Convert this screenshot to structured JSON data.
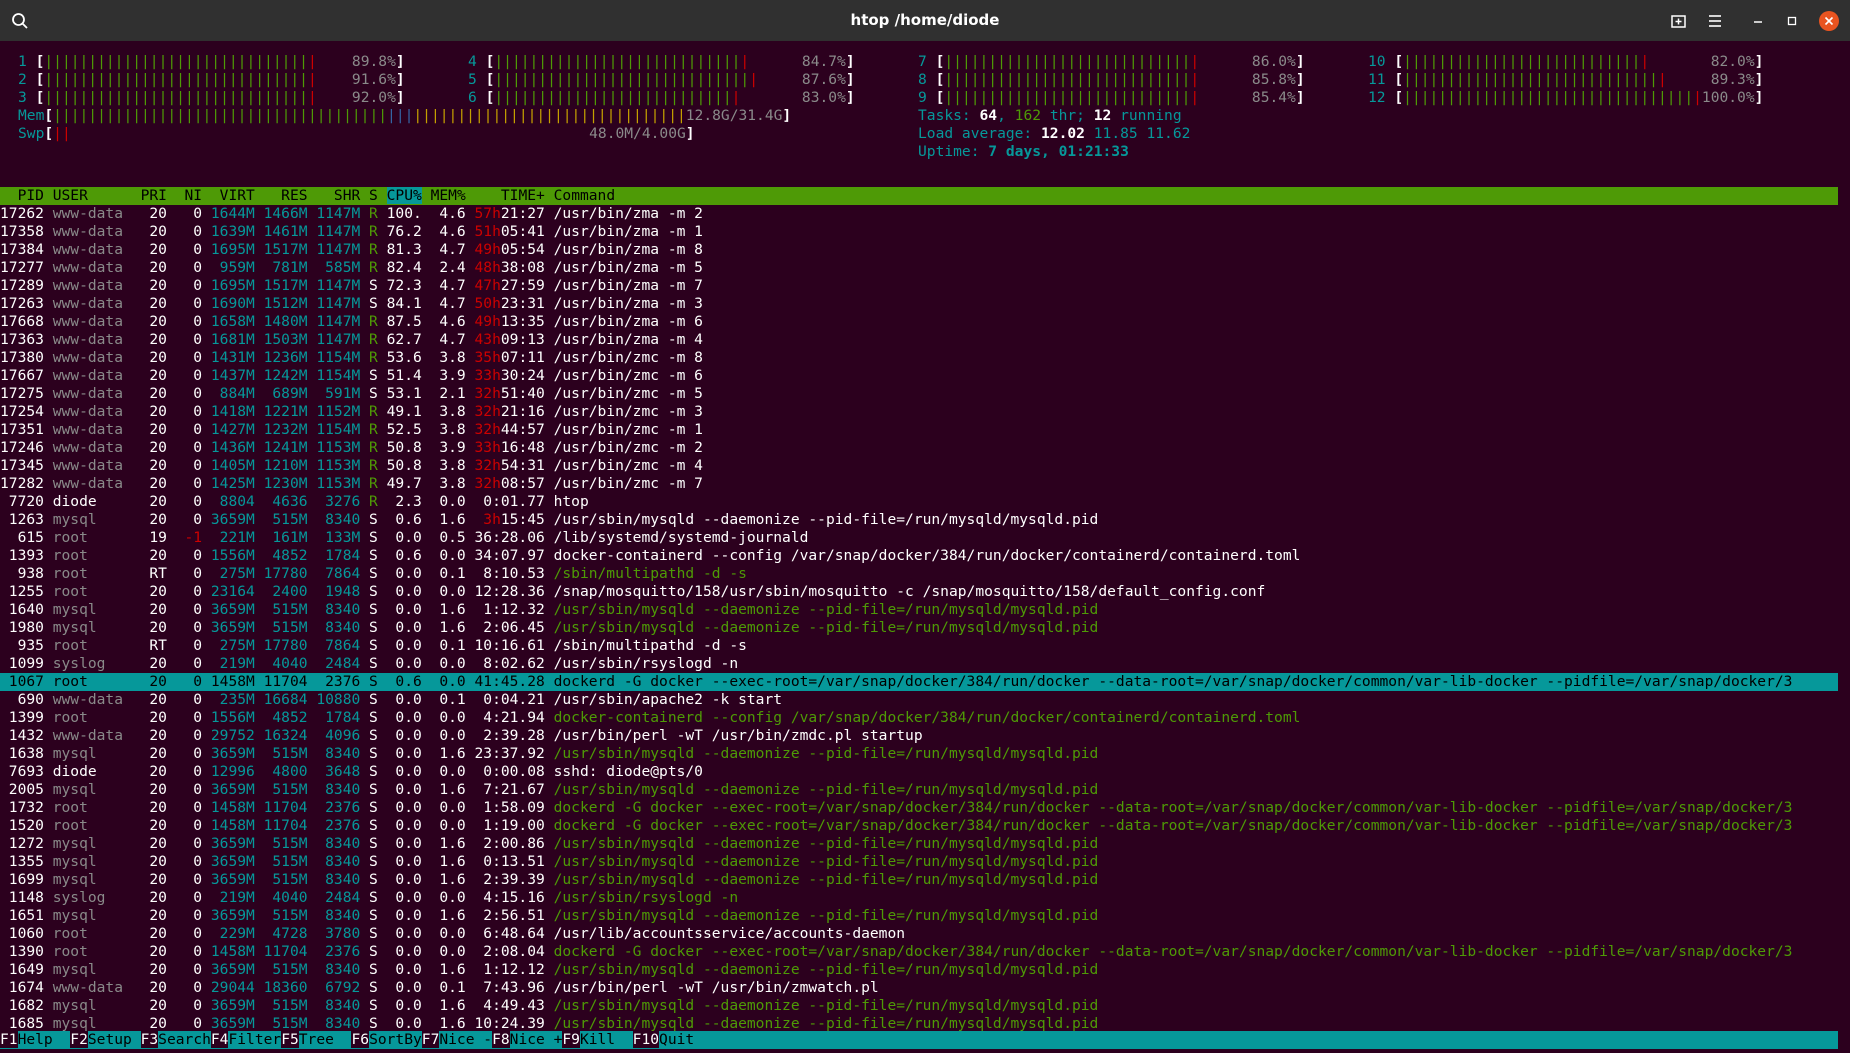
{
  "window": {
    "title": "htop /home/diode"
  },
  "meters": {
    "cpus": [
      {
        "id": "1",
        "pct": 89.8,
        "label": "89.8%"
      },
      {
        "id": "2",
        "pct": 91.6,
        "label": "91.6%"
      },
      {
        "id": "3",
        "pct": 92.0,
        "label": "92.0%"
      },
      {
        "id": "4",
        "pct": 84.7,
        "label": "84.7%"
      },
      {
        "id": "5",
        "pct": 87.6,
        "label": "87.6%"
      },
      {
        "id": "6",
        "pct": 83.0,
        "label": "83.0%"
      },
      {
        "id": "7",
        "pct": 86.0,
        "label": "86.0%"
      },
      {
        "id": "8",
        "pct": 85.8,
        "label": "85.8%"
      },
      {
        "id": "9",
        "pct": 85.4,
        "label": "85.4%"
      },
      {
        "id": "10",
        "pct": 82.0,
        "label": "82.0%"
      },
      {
        "id": "11",
        "pct": 89.3,
        "label": "89.3%"
      },
      {
        "id": "12",
        "pct": 100.0,
        "label": "100.0%"
      }
    ],
    "mem": {
      "label": "Mem",
      "value": "12.8G/31.4G",
      "pct": 40.8
    },
    "swp": {
      "label": "Swp",
      "value": "48.0M/4.00G",
      "pct": 1.2
    },
    "tasks": {
      "prefix": "Tasks: ",
      "tasks": "64",
      "sep1": ", ",
      "thr": "162",
      "sep2": " thr; ",
      "running": "12",
      "suffix": " running"
    },
    "load": {
      "prefix": "Load average: ",
      "l1": "12.02",
      "l5": "11.85",
      "l15": "11.62"
    },
    "uptime": {
      "prefix": "Uptime: ",
      "value": "7 days, 01:21:33"
    }
  },
  "columns": [
    "PID",
    "USER",
    "PRI",
    "NI",
    "VIRT",
    "RES",
    "SHR",
    "S",
    "CPU%",
    "MEM%",
    "TIME+",
    "Command"
  ],
  "sort_column": "CPU%",
  "selected_pid": "1067",
  "processes": [
    {
      "pid": "17262",
      "user": "www-data",
      "pri": "20",
      "ni": "0",
      "virt": "1644M",
      "res": "1466M",
      "shr": "1147M",
      "s": "R",
      "cpu": "100.",
      "mem": "4.6",
      "time": "57h21:27",
      "cmd": "/usr/bin/zma -m 2"
    },
    {
      "pid": "17358",
      "user": "www-data",
      "pri": "20",
      "ni": "0",
      "virt": "1639M",
      "res": "1461M",
      "shr": "1147M",
      "s": "R",
      "cpu": "76.2",
      "mem": "4.6",
      "time": "51h05:41",
      "cmd": "/usr/bin/zma -m 1"
    },
    {
      "pid": "17384",
      "user": "www-data",
      "pri": "20",
      "ni": "0",
      "virt": "1695M",
      "res": "1517M",
      "shr": "1147M",
      "s": "R",
      "cpu": "81.3",
      "mem": "4.7",
      "time": "49h05:54",
      "cmd": "/usr/bin/zma -m 8"
    },
    {
      "pid": "17277",
      "user": "www-data",
      "pri": "20",
      "ni": "0",
      "virt": "959M",
      "res": "781M",
      "shr": "585M",
      "s": "R",
      "cpu": "82.4",
      "mem": "2.4",
      "time": "48h38:08",
      "cmd": "/usr/bin/zma -m 5"
    },
    {
      "pid": "17289",
      "user": "www-data",
      "pri": "20",
      "ni": "0",
      "virt": "1695M",
      "res": "1517M",
      "shr": "1147M",
      "s": "S",
      "cpu": "72.3",
      "mem": "4.7",
      "time": "47h27:59",
      "cmd": "/usr/bin/zma -m 7"
    },
    {
      "pid": "17263",
      "user": "www-data",
      "pri": "20",
      "ni": "0",
      "virt": "1690M",
      "res": "1512M",
      "shr": "1147M",
      "s": "S",
      "cpu": "84.1",
      "mem": "4.7",
      "time": "50h23:31",
      "cmd": "/usr/bin/zma -m 3"
    },
    {
      "pid": "17668",
      "user": "www-data",
      "pri": "20",
      "ni": "0",
      "virt": "1658M",
      "res": "1480M",
      "shr": "1147M",
      "s": "R",
      "cpu": "87.5",
      "mem": "4.6",
      "time": "49h13:35",
      "cmd": "/usr/bin/zma -m 6"
    },
    {
      "pid": "17363",
      "user": "www-data",
      "pri": "20",
      "ni": "0",
      "virt": "1681M",
      "res": "1503M",
      "shr": "1147M",
      "s": "R",
      "cpu": "62.7",
      "mem": "4.7",
      "time": "43h09:13",
      "cmd": "/usr/bin/zma -m 4"
    },
    {
      "pid": "17380",
      "user": "www-data",
      "pri": "20",
      "ni": "0",
      "virt": "1431M",
      "res": "1236M",
      "shr": "1154M",
      "s": "R",
      "cpu": "53.6",
      "mem": "3.8",
      "time": "35h07:11",
      "cmd": "/usr/bin/zmc -m 8"
    },
    {
      "pid": "17667",
      "user": "www-data",
      "pri": "20",
      "ni": "0",
      "virt": "1437M",
      "res": "1242M",
      "shr": "1154M",
      "s": "S",
      "cpu": "51.4",
      "mem": "3.9",
      "time": "33h30:24",
      "cmd": "/usr/bin/zmc -m 6"
    },
    {
      "pid": "17275",
      "user": "www-data",
      "pri": "20",
      "ni": "0",
      "virt": "884M",
      "res": "689M",
      "shr": "591M",
      "s": "S",
      "cpu": "53.1",
      "mem": "2.1",
      "time": "32h51:40",
      "cmd": "/usr/bin/zmc -m 5"
    },
    {
      "pid": "17254",
      "user": "www-data",
      "pri": "20",
      "ni": "0",
      "virt": "1418M",
      "res": "1221M",
      "shr": "1152M",
      "s": "R",
      "cpu": "49.1",
      "mem": "3.8",
      "time": "32h21:16",
      "cmd": "/usr/bin/zmc -m 3"
    },
    {
      "pid": "17351",
      "user": "www-data",
      "pri": "20",
      "ni": "0",
      "virt": "1427M",
      "res": "1232M",
      "shr": "1154M",
      "s": "R",
      "cpu": "52.5",
      "mem": "3.8",
      "time": "32h44:57",
      "cmd": "/usr/bin/zmc -m 1"
    },
    {
      "pid": "17246",
      "user": "www-data",
      "pri": "20",
      "ni": "0",
      "virt": "1436M",
      "res": "1241M",
      "shr": "1153M",
      "s": "R",
      "cpu": "50.8",
      "mem": "3.9",
      "time": "33h16:48",
      "cmd": "/usr/bin/zmc -m 2"
    },
    {
      "pid": "17345",
      "user": "www-data",
      "pri": "20",
      "ni": "0",
      "virt": "1405M",
      "res": "1210M",
      "shr": "1153M",
      "s": "R",
      "cpu": "50.8",
      "mem": "3.8",
      "time": "32h54:31",
      "cmd": "/usr/bin/zmc -m 4"
    },
    {
      "pid": "17282",
      "user": "www-data",
      "pri": "20",
      "ni": "0",
      "virt": "1425M",
      "res": "1230M",
      "shr": "1153M",
      "s": "R",
      "cpu": "49.7",
      "mem": "3.8",
      "time": "32h08:57",
      "cmd": "/usr/bin/zmc -m 7"
    },
    {
      "pid": "7720",
      "user": "diode",
      "pri": "20",
      "ni": "0",
      "virt": "8804",
      "res": "4636",
      "shr": "3276",
      "s": "R",
      "cpu": "2.3",
      "mem": "0.0",
      "time": "0:01.77",
      "cmd": "htop"
    },
    {
      "pid": "1263",
      "user": "mysql",
      "pri": "20",
      "ni": "0",
      "virt": "3659M",
      "res": "515M",
      "shr": "8340",
      "s": "S",
      "cpu": "0.6",
      "mem": "1.6",
      "time": "3h15:45",
      "cmd": "/usr/sbin/mysqld --daemonize --pid-file=/run/mysqld/mysqld.pid"
    },
    {
      "pid": "615",
      "user": "root",
      "pri": "19",
      "ni": "-1",
      "virt": "221M",
      "res": "161M",
      "shr": "133M",
      "s": "S",
      "cpu": "0.0",
      "mem": "0.5",
      "time": "36:28.06",
      "cmd": "/lib/systemd/systemd-journald"
    },
    {
      "pid": "1393",
      "user": "root",
      "pri": "20",
      "ni": "0",
      "virt": "1556M",
      "res": "4852",
      "shr": "1784",
      "s": "S",
      "cpu": "0.6",
      "mem": "0.0",
      "time": "34:07.97",
      "cmd": "docker-containerd --config /var/snap/docker/384/run/docker/containerd/containerd.toml"
    },
    {
      "pid": "938",
      "user": "root",
      "pri": "RT",
      "ni": "0",
      "virt": "275M",
      "res": "17780",
      "shr": "7864",
      "s": "S",
      "cpu": "0.0",
      "mem": "0.1",
      "time": "8:10.53",
      "cmd": "/sbin/multipathd -d -s",
      "thread": true
    },
    {
      "pid": "1255",
      "user": "root",
      "pri": "20",
      "ni": "0",
      "virt": "23164",
      "res": "2400",
      "shr": "1948",
      "s": "S",
      "cpu": "0.0",
      "mem": "0.0",
      "time": "12:28.36",
      "cmd": "/snap/mosquitto/158/usr/sbin/mosquitto -c /snap/mosquitto/158/default_config.conf"
    },
    {
      "pid": "1640",
      "user": "mysql",
      "pri": "20",
      "ni": "0",
      "virt": "3659M",
      "res": "515M",
      "shr": "8340",
      "s": "S",
      "cpu": "0.0",
      "mem": "1.6",
      "time": "1:12.32",
      "cmd": "/usr/sbin/mysqld --daemonize --pid-file=/run/mysqld/mysqld.pid",
      "thread": true
    },
    {
      "pid": "1980",
      "user": "mysql",
      "pri": "20",
      "ni": "0",
      "virt": "3659M",
      "res": "515M",
      "shr": "8340",
      "s": "S",
      "cpu": "0.0",
      "mem": "1.6",
      "time": "2:06.45",
      "cmd": "/usr/sbin/mysqld --daemonize --pid-file=/run/mysqld/mysqld.pid",
      "thread": true
    },
    {
      "pid": "935",
      "user": "root",
      "pri": "RT",
      "ni": "0",
      "virt": "275M",
      "res": "17780",
      "shr": "7864",
      "s": "S",
      "cpu": "0.0",
      "mem": "0.1",
      "time": "10:16.61",
      "cmd": "/sbin/multipathd -d -s"
    },
    {
      "pid": "1099",
      "user": "syslog",
      "pri": "20",
      "ni": "0",
      "virt": "219M",
      "res": "4040",
      "shr": "2484",
      "s": "S",
      "cpu": "0.0",
      "mem": "0.0",
      "time": "8:02.62",
      "cmd": "/usr/sbin/rsyslogd -n"
    },
    {
      "pid": "1067",
      "user": "root",
      "pri": "20",
      "ni": "0",
      "virt": "1458M",
      "res": "11704",
      "shr": "2376",
      "s": "S",
      "cpu": "0.6",
      "mem": "0.0",
      "time": "41:45.28",
      "cmd": "dockerd -G docker --exec-root=/var/snap/docker/384/run/docker --data-root=/var/snap/docker/common/var-lib-docker --pidfile=/var/snap/docker/3"
    },
    {
      "pid": "690",
      "user": "www-data",
      "pri": "20",
      "ni": "0",
      "virt": "235M",
      "res": "16684",
      "shr": "10880",
      "s": "S",
      "cpu": "0.0",
      "mem": "0.1",
      "time": "0:04.21",
      "cmd": "/usr/sbin/apache2 -k start"
    },
    {
      "pid": "1399",
      "user": "root",
      "pri": "20",
      "ni": "0",
      "virt": "1556M",
      "res": "4852",
      "shr": "1784",
      "s": "S",
      "cpu": "0.0",
      "mem": "0.0",
      "time": "4:21.94",
      "cmd": "docker-containerd --config /var/snap/docker/384/run/docker/containerd/containerd.toml",
      "thread": true
    },
    {
      "pid": "1432",
      "user": "www-data",
      "pri": "20",
      "ni": "0",
      "virt": "29752",
      "res": "16324",
      "shr": "4096",
      "s": "S",
      "cpu": "0.0",
      "mem": "0.0",
      "time": "2:39.28",
      "cmd": "/usr/bin/perl -wT /usr/bin/zmdc.pl startup"
    },
    {
      "pid": "1638",
      "user": "mysql",
      "pri": "20",
      "ni": "0",
      "virt": "3659M",
      "res": "515M",
      "shr": "8340",
      "s": "S",
      "cpu": "0.0",
      "mem": "1.6",
      "time": "23:37.92",
      "cmd": "/usr/sbin/mysqld --daemonize --pid-file=/run/mysqld/mysqld.pid",
      "thread": true
    },
    {
      "pid": "7693",
      "user": "diode",
      "pri": "20",
      "ni": "0",
      "virt": "12996",
      "res": "4800",
      "shr": "3648",
      "s": "S",
      "cpu": "0.0",
      "mem": "0.0",
      "time": "0:00.08",
      "cmd": "sshd: diode@pts/0"
    },
    {
      "pid": "2005",
      "user": "mysql",
      "pri": "20",
      "ni": "0",
      "virt": "3659M",
      "res": "515M",
      "shr": "8340",
      "s": "S",
      "cpu": "0.0",
      "mem": "1.6",
      "time": "7:21.67",
      "cmd": "/usr/sbin/mysqld --daemonize --pid-file=/run/mysqld/mysqld.pid",
      "thread": true
    },
    {
      "pid": "1732",
      "user": "root",
      "pri": "20",
      "ni": "0",
      "virt": "1458M",
      "res": "11704",
      "shr": "2376",
      "s": "S",
      "cpu": "0.0",
      "mem": "0.0",
      "time": "1:58.09",
      "cmd": "dockerd -G docker --exec-root=/var/snap/docker/384/run/docker --data-root=/var/snap/docker/common/var-lib-docker --pidfile=/var/snap/docker/3",
      "thread": true
    },
    {
      "pid": "1520",
      "user": "root",
      "pri": "20",
      "ni": "0",
      "virt": "1458M",
      "res": "11704",
      "shr": "2376",
      "s": "S",
      "cpu": "0.0",
      "mem": "0.0",
      "time": "1:19.00",
      "cmd": "dockerd -G docker --exec-root=/var/snap/docker/384/run/docker --data-root=/var/snap/docker/common/var-lib-docker --pidfile=/var/snap/docker/3",
      "thread": true
    },
    {
      "pid": "1272",
      "user": "mysql",
      "pri": "20",
      "ni": "0",
      "virt": "3659M",
      "res": "515M",
      "shr": "8340",
      "s": "S",
      "cpu": "0.0",
      "mem": "1.6",
      "time": "2:00.86",
      "cmd": "/usr/sbin/mysqld --daemonize --pid-file=/run/mysqld/mysqld.pid",
      "thread": true
    },
    {
      "pid": "1355",
      "user": "mysql",
      "pri": "20",
      "ni": "0",
      "virt": "3659M",
      "res": "515M",
      "shr": "8340",
      "s": "S",
      "cpu": "0.0",
      "mem": "1.6",
      "time": "0:13.51",
      "cmd": "/usr/sbin/mysqld --daemonize --pid-file=/run/mysqld/mysqld.pid",
      "thread": true
    },
    {
      "pid": "1699",
      "user": "mysql",
      "pri": "20",
      "ni": "0",
      "virt": "3659M",
      "res": "515M",
      "shr": "8340",
      "s": "S",
      "cpu": "0.0",
      "mem": "1.6",
      "time": "2:39.39",
      "cmd": "/usr/sbin/mysqld --daemonize --pid-file=/run/mysqld/mysqld.pid",
      "thread": true
    },
    {
      "pid": "1148",
      "user": "syslog",
      "pri": "20",
      "ni": "0",
      "virt": "219M",
      "res": "4040",
      "shr": "2484",
      "s": "S",
      "cpu": "0.0",
      "mem": "0.0",
      "time": "4:15.16",
      "cmd": "/usr/sbin/rsyslogd -n",
      "thread": true
    },
    {
      "pid": "1651",
      "user": "mysql",
      "pri": "20",
      "ni": "0",
      "virt": "3659M",
      "res": "515M",
      "shr": "8340",
      "s": "S",
      "cpu": "0.0",
      "mem": "1.6",
      "time": "2:56.51",
      "cmd": "/usr/sbin/mysqld --daemonize --pid-file=/run/mysqld/mysqld.pid",
      "thread": true
    },
    {
      "pid": "1060",
      "user": "root",
      "pri": "20",
      "ni": "0",
      "virt": "229M",
      "res": "4728",
      "shr": "3780",
      "s": "S",
      "cpu": "0.0",
      "mem": "0.0",
      "time": "6:48.64",
      "cmd": "/usr/lib/accountsservice/accounts-daemon"
    },
    {
      "pid": "1390",
      "user": "root",
      "pri": "20",
      "ni": "0",
      "virt": "1458M",
      "res": "11704",
      "shr": "2376",
      "s": "S",
      "cpu": "0.0",
      "mem": "0.0",
      "time": "2:08.04",
      "cmd": "dockerd -G docker --exec-root=/var/snap/docker/384/run/docker --data-root=/var/snap/docker/common/var-lib-docker --pidfile=/var/snap/docker/3",
      "thread": true
    },
    {
      "pid": "1649",
      "user": "mysql",
      "pri": "20",
      "ni": "0",
      "virt": "3659M",
      "res": "515M",
      "shr": "8340",
      "s": "S",
      "cpu": "0.0",
      "mem": "1.6",
      "time": "1:12.12",
      "cmd": "/usr/sbin/mysqld --daemonize --pid-file=/run/mysqld/mysqld.pid",
      "thread": true
    },
    {
      "pid": "1674",
      "user": "www-data",
      "pri": "20",
      "ni": "0",
      "virt": "29044",
      "res": "18360",
      "shr": "6792",
      "s": "S",
      "cpu": "0.0",
      "mem": "0.1",
      "time": "7:43.96",
      "cmd": "/usr/bin/perl -wT /usr/bin/zmwatch.pl"
    },
    {
      "pid": "1682",
      "user": "mysql",
      "pri": "20",
      "ni": "0",
      "virt": "3659M",
      "res": "515M",
      "shr": "8340",
      "s": "S",
      "cpu": "0.0",
      "mem": "1.6",
      "time": "4:49.43",
      "cmd": "/usr/sbin/mysqld --daemonize --pid-file=/run/mysqld/mysqld.pid",
      "thread": true
    },
    {
      "pid": "1685",
      "user": "mysql",
      "pri": "20",
      "ni": "0",
      "virt": "3659M",
      "res": "515M",
      "shr": "8340",
      "s": "S",
      "cpu": "0.0",
      "mem": "1.6",
      "time": "10:24.39",
      "cmd": "/usr/sbin/mysqld --daemonize --pid-file=/run/mysqld/mysqld.pid",
      "thread": true
    }
  ],
  "function_keys": [
    {
      "key": "F1",
      "label": "Help  "
    },
    {
      "key": "F2",
      "label": "Setup "
    },
    {
      "key": "F3",
      "label": "Search"
    },
    {
      "key": "F4",
      "label": "Filter"
    },
    {
      "key": "F5",
      "label": "Tree  "
    },
    {
      "key": "F6",
      "label": "SortBy"
    },
    {
      "key": "F7",
      "label": "Nice -"
    },
    {
      "key": "F8",
      "label": "Nice +"
    },
    {
      "key": "F9",
      "label": "Kill  "
    },
    {
      "key": "F10",
      "label": "Quit"
    }
  ],
  "colors": {
    "background": "#2c001e",
    "titlebar": "#303030",
    "header_bg": "#4e9a06",
    "selection_bg": "#06989a",
    "cyan": "#06989a",
    "green": "#4e9a06",
    "red": "#cc0000",
    "blue": "#3465a4",
    "yellow": "#c4a000"
  },
  "icons": {
    "search": "search-icon",
    "new_tab": "new-tab-icon",
    "menu": "hamburger-menu-icon",
    "minimize": "minimize-icon",
    "maximize": "maximize-icon",
    "close": "close-icon"
  }
}
